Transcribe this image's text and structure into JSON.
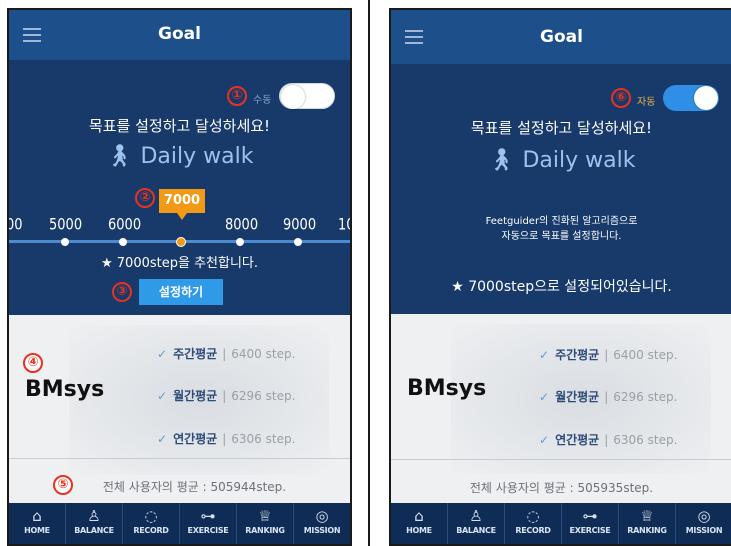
{
  "left": {
    "title": "Goal",
    "callouts": [
      "①",
      "②",
      "③",
      "④",
      "⑤"
    ],
    "toggle_label": "수동",
    "toggle_state": "off",
    "headline": "목표를 설정하고 달성하세요!",
    "daily_walk": "Daily walk",
    "selected_value": "7000",
    "slider_ticks": [
      "00",
      "5000",
      "6000",
      "7000",
      "8000",
      "9000",
      "10"
    ],
    "recommend": "★ 7000step을 추천합니다.",
    "set_button": "설정하기",
    "brand": "BMsys",
    "stats": [
      {
        "label": "주간평균",
        "value": "6400 step."
      },
      {
        "label": "월간평균",
        "value": "6296 step."
      },
      {
        "label": "연간평균",
        "value": "6306 step."
      }
    ],
    "overall": "전체 사용자의 평균 : 505944step."
  },
  "right": {
    "title": "Goal",
    "callouts": [
      "⑥"
    ],
    "toggle_label": "자동",
    "toggle_state": "on",
    "headline": "목표를 설정하고 달성하세요!",
    "daily_walk": "Daily walk",
    "desc_line1": "Feetguider의 진화된 알고리즘으로",
    "desc_line2": "자동으로 목표를 설정합니다.",
    "status": "★ 7000step으로 설정되어있습니다.",
    "brand": "BMsys",
    "stats": [
      {
        "label": "주간평균",
        "value": "6400 step."
      },
      {
        "label": "월간평균",
        "value": "6296 step."
      },
      {
        "label": "연간평균",
        "value": "6306 step."
      }
    ],
    "overall": "전체 사용자의 평균 : 505935step."
  },
  "tabs": [
    {
      "label": "HOME",
      "icon": "home-icon",
      "glyph": "⌂"
    },
    {
      "label": "BALANCE",
      "icon": "balance-icon",
      "glyph": "♙"
    },
    {
      "label": "RECORD",
      "icon": "record-icon",
      "glyph": "◌"
    },
    {
      "label": "EXERCISE",
      "icon": "exercise-icon",
      "glyph": "⊶"
    },
    {
      "label": "RANKING",
      "icon": "ranking-icon",
      "glyph": "♕"
    },
    {
      "label": "MISSION",
      "icon": "mission-icon",
      "glyph": "◎"
    }
  ],
  "colors": {
    "header": "#1d4f8a",
    "panel": "#173a6b",
    "accent_orange": "#f29a16",
    "accent_blue": "#2f9be8",
    "callout_red": "#e8321e"
  }
}
